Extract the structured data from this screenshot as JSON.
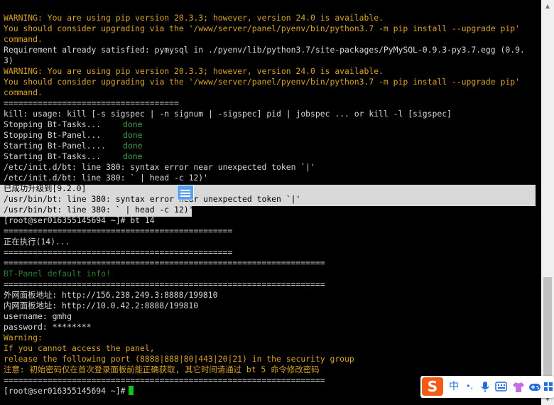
{
  "terminal": {
    "lines": [
      {
        "text": "WARNING: You are using pip version 20.3.3; however, version 24.0 is available.",
        "tone": "warn"
      },
      {
        "text": "You should consider upgrading via the '/www/server/panel/pyenv/bin/python3.7 -m pip install --upgrade pip'",
        "tone": "warn"
      },
      {
        "text": "command.",
        "tone": "warn"
      },
      {
        "text": "Requirement already satisfied: pymysql in ./pyenv/lib/python3.7/site-packages/PyMySQL-0.9.3-py3.7.egg (0.9.",
        "tone": "normal"
      },
      {
        "text": "3)",
        "tone": "normal"
      },
      {
        "text": "WARNING: You are using pip version 20.3.3; however, version 24.0 is available.",
        "tone": "warn"
      },
      {
        "text": "You should consider upgrading via the '/www/server/panel/pyenv/bin/python3.7 -m pip install --upgrade pip'",
        "tone": "warn"
      },
      {
        "text": "command.",
        "tone": "warn"
      },
      {
        "text": "====================================",
        "tone": "normal"
      },
      {
        "text": "kill: usage: kill [-s sigspec | -n signum | -sigspec] pid | jobspec ... or kill -l [sigspec]",
        "tone": "normal"
      },
      {
        "text": "Stopping Bt-Tasks...",
        "status": "done"
      },
      {
        "text": "Stopping Bt-Panel...",
        "status": "done"
      },
      {
        "text": "Starting Bt-Panel....",
        "status": "done"
      },
      {
        "text": "Starting Bt-Tasks...",
        "status": "done"
      },
      {
        "text": "/etc/init.d/bt: line 380: syntax error near unexpected token `|'",
        "tone": "normal"
      },
      {
        "text": "/etc/init.d/bt: line 380: ` | head -c 12)'",
        "tone": "normal"
      },
      {
        "text": "已成功升级到[9.2.0]",
        "tone": "selected"
      },
      {
        "text": "/usr/bin/bt: line 380: syntax error near unexpected token `|'",
        "tone": "selected"
      },
      {
        "text": "/usr/bin/bt: line 380: ` | head -c 12)'",
        "tone": "selected"
      },
      {
        "text": "[root@ser016355145694 ~]# bt 14",
        "tone": "normal"
      },
      {
        "text": "===============================================",
        "tone": "normal"
      },
      {
        "text": "正在执行(14)...",
        "tone": "normal"
      },
      {
        "text": "===============================================",
        "tone": "normal"
      },
      {
        "text": "==================================================================",
        "tone": "normal"
      },
      {
        "text": "BT-Panel default info!",
        "tone": "info"
      },
      {
        "text": "==================================================================",
        "tone": "normal"
      },
      {
        "text": "外网面板地址: http://156.238.249.3:8888/199810",
        "tone": "normal"
      },
      {
        "text": "内网面板地址: http://10.0.42.2:8888/199810",
        "tone": "normal"
      },
      {
        "text": "username: gmhg",
        "tone": "normal"
      },
      {
        "text": "password: ********",
        "tone": "normal"
      },
      {
        "text": "Warning:",
        "tone": "warn"
      },
      {
        "text": "If you cannot access the panel,",
        "tone": "warn"
      },
      {
        "text": "release the following port (8888|888|80|443|20|21) in the security group",
        "tone": "warn"
      },
      {
        "text": "注意: 初始密码仅在首次登录面板前能正确获取, 其它时间请通过 bt 5 命令修改密码",
        "tone": "warn"
      },
      {
        "text": "==================================================================",
        "tone": "normal"
      },
      {
        "text": "[root@ser016355145694 ~]#",
        "tone": "normal",
        "cursor": true
      }
    ],
    "status_done": "done",
    "colors": {
      "background": "#000000",
      "text": "#d8d8d8",
      "warning": "#d7a22a",
      "done": "#43a047",
      "info": "#2e7d32",
      "cursor": "#16c216",
      "selection": "#d9d9d9"
    }
  },
  "ime": {
    "logo": "S",
    "mode": "中",
    "punct": "•,",
    "icons": [
      "microphone-icon",
      "keyboard-icon",
      "shirt-icon",
      "game-icon",
      "grid-icon"
    ]
  },
  "scrollbar": {
    "up": "▲",
    "down": "▼"
  }
}
